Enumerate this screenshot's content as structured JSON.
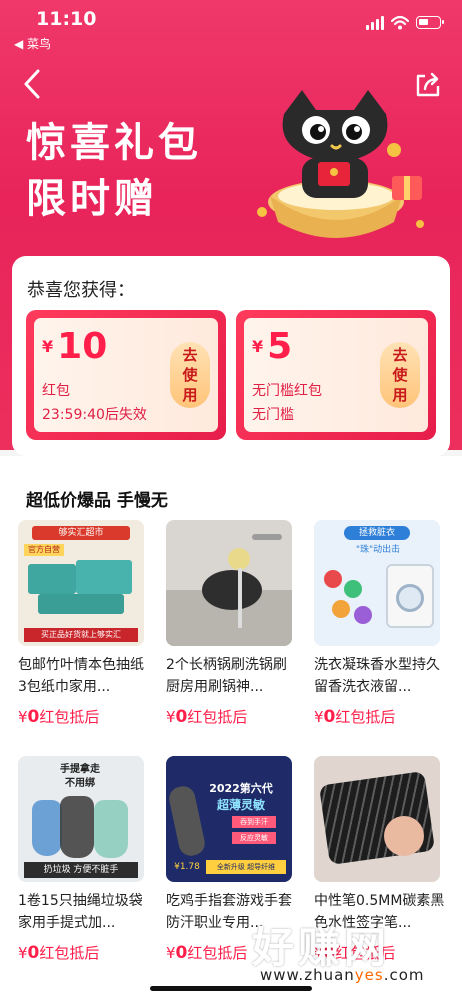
{
  "status_bar": {
    "time": "11:10",
    "back_app": "◀ 菜鸟"
  },
  "hero": {
    "title_line1": "惊喜礼包",
    "title_line2": "限时赠",
    "colors": {
      "gradient_top": "#f0386a",
      "gradient_bottom": "#ec2f5d"
    }
  },
  "panel": {
    "title": "恭喜您获得：",
    "coupons": [
      {
        "currency": "¥",
        "amount": "10",
        "label": "红包",
        "sub": "23:59:40后失效",
        "button": "去使用"
      },
      {
        "currency": "¥",
        "amount": "5",
        "label": "无门槛红包",
        "sub": "无门槛",
        "button": "去使用"
      }
    ]
  },
  "section": {
    "title": "超低价爆品 手慢无",
    "products": [
      {
        "name": "包邮竹叶情本色抽纸3包纸巾家用...",
        "price_symbol": "¥",
        "price": "0",
        "price_note": "红包抵后",
        "image_text": [
          "够实汇超市",
          "官方自营",
          "买正品好货就上够实汇"
        ]
      },
      {
        "name": "2个长柄锅刷洗锅刷厨房用刷锅神...",
        "price_symbol": "¥",
        "price": "0",
        "price_note": "红包抵后",
        "image_text": []
      },
      {
        "name": "洗衣凝珠香水型持久留香洗衣液留...",
        "price_symbol": "¥",
        "price": "0",
        "price_note": "红包抵后",
        "image_text": [
          "拯救脏衣",
          "\"珠\"动出击"
        ]
      },
      {
        "name": "1卷15只抽绳垃圾袋家用手提式加...",
        "price_symbol": "¥",
        "price": "0",
        "price_note": "红包抵后",
        "image_text": [
          "手提拿走",
          "不用绑",
          "扔垃圾  方便不脏手"
        ]
      },
      {
        "name": "吃鸡手指套游戏手套防汗职业专用...",
        "price_symbol": "¥",
        "price": "0",
        "price_note": "红包抵后",
        "image_text": [
          "2022第六代",
          "超薄灵敏",
          "吞到手汗",
          "反应灵敏",
          "全新升级 超导纤维",
          "¥1.78"
        ]
      },
      {
        "name": "中性笔0.5MM碳素黑色水性签字笔...",
        "price_symbol": "¥",
        "price": "0",
        "price_note": "红包抵后",
        "image_text": []
      }
    ]
  },
  "watermark": {
    "main": "好赚网",
    "url_prefix": "www.zhuan",
    "url_accent": "yes",
    "url_suffix": ".com"
  }
}
